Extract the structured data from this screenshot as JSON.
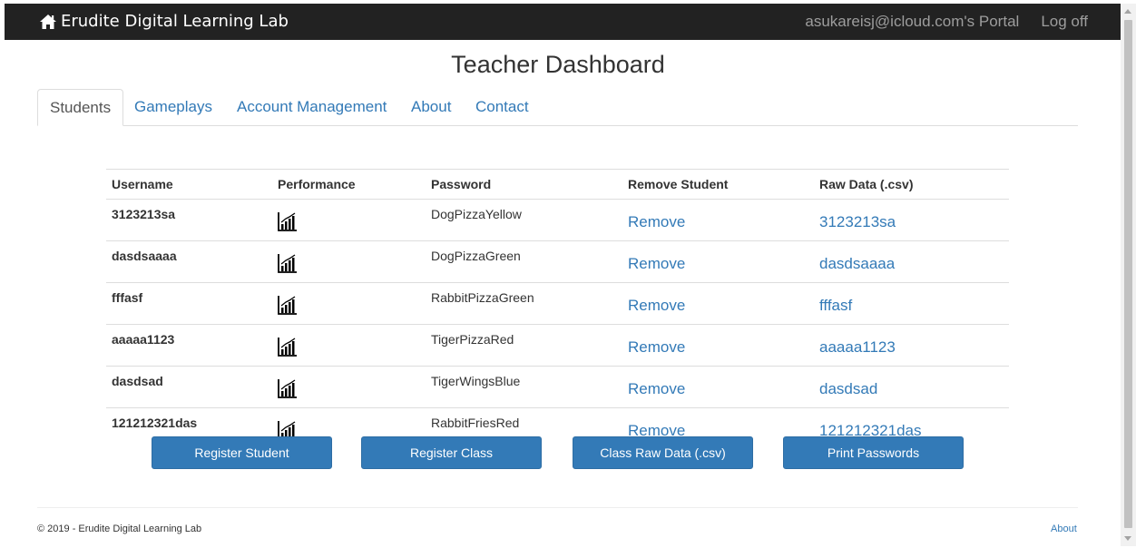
{
  "navbar": {
    "brand": "Erudite Digital Learning Lab",
    "portal_label": "asukareisj@icloud.com's Portal",
    "logoff_label": "Log off"
  },
  "page_title": "Teacher Dashboard",
  "tabs": [
    "Students",
    "Gameplays",
    "Account Management",
    "About",
    "Contact"
  ],
  "active_tab": "Students",
  "table": {
    "headers": [
      "Username",
      "Performance",
      "Password",
      "Remove Student",
      "Raw Data (.csv)"
    ],
    "rows": [
      {
        "username": "3123213sa",
        "password": "DogPizzaYellow",
        "remove": "Remove",
        "raw": "3123213sa"
      },
      {
        "username": "dasdsaaaa",
        "password": "DogPizzaGreen",
        "remove": "Remove",
        "raw": "dasdsaaaa"
      },
      {
        "username": "fffasf",
        "password": "RabbitPizzaGreen",
        "remove": "Remove",
        "raw": "fffasf"
      },
      {
        "username": "aaaaa1123",
        "password": "TigerPizzaRed",
        "remove": "Remove",
        "raw": "aaaaa1123"
      },
      {
        "username": "dasdsad",
        "password": "TigerWingsBlue",
        "remove": "Remove",
        "raw": "dasdsad"
      },
      {
        "username": "121212321das",
        "password": "RabbitFriesRed",
        "remove": "Remove",
        "raw": "121212321das"
      }
    ],
    "performance_icon": "bar-chart-icon"
  },
  "buttons": {
    "register_student": "Register Student",
    "register_class": "Register Class",
    "class_raw_data": "Class Raw Data (.csv)",
    "print_passwords": "Print Passwords"
  },
  "footer": {
    "copyright": "© 2019 - Erudite Digital Learning Lab",
    "about": "About"
  },
  "colors": {
    "navbar_bg": "#222222",
    "link": "#337ab7",
    "button_bg": "#337ab7"
  }
}
